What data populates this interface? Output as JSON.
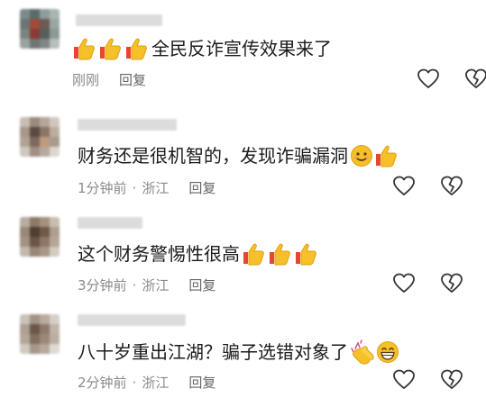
{
  "comments": [
    {
      "text": "全民反诈宣传效果来了",
      "time": "刚刚",
      "location": "",
      "reply_label": "回复",
      "leading_emojis": [
        "thumbs-up-icon",
        "thumbs-up-icon",
        "thumbs-up-icon"
      ],
      "trailing_emojis": []
    },
    {
      "text": "财务还是很机智的，发现诈骗漏洞",
      "time": "1分钟前",
      "location": "浙江",
      "reply_label": "回复",
      "leading_emojis": [],
      "trailing_emojis": [
        "smiling-face-icon",
        "thumbs-up-icon"
      ]
    },
    {
      "text": "这个财务警惕性很高",
      "time": "3分钟前",
      "location": "浙江",
      "reply_label": "回复",
      "leading_emojis": [],
      "trailing_emojis": [
        "thumbs-up-icon",
        "thumbs-up-icon",
        "thumbs-up-icon"
      ]
    },
    {
      "text": "八十岁重出江湖？骗子选错对象了",
      "time": "2分钟前",
      "location": "浙江",
      "reply_label": "回复",
      "leading_emojis": [],
      "trailing_emojis": [
        "clapping-hands-icon",
        "grinning-face-icon"
      ]
    }
  ],
  "separator": "·",
  "colors": {
    "text": "#1b1b1b",
    "meta": "#8a8a8a",
    "icon_stroke": "#333333",
    "emoji_yellow": "#f6c028",
    "emoji_red": "#e8452d"
  }
}
